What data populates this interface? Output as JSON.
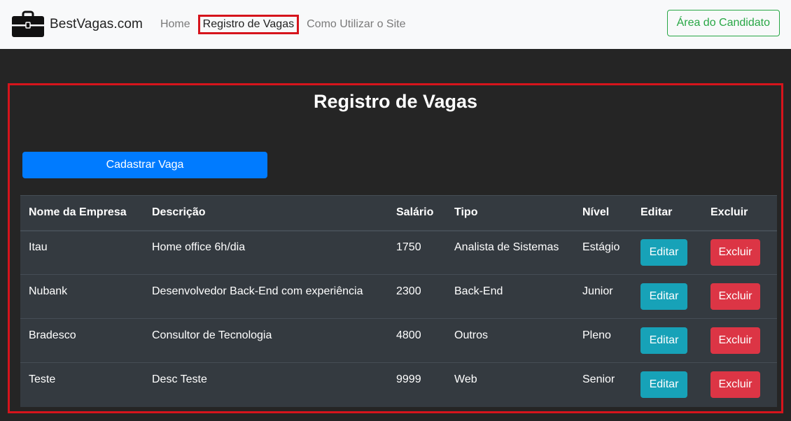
{
  "brand": {
    "name": "BestVagas.com",
    "logo_icon": "briefcase-icon"
  },
  "nav": {
    "links": [
      {
        "label": "Home",
        "active": false
      },
      {
        "label": "Registro de Vagas",
        "active": true
      },
      {
        "label": "Como Utilizar o Site",
        "active": false
      }
    ],
    "candidate_button": "Área do Candidato"
  },
  "main": {
    "title": "Registro de Vagas",
    "add_button": "Cadastrar Vaga"
  },
  "table": {
    "headers": [
      "Nome da Empresa",
      "Descrição",
      "Salário",
      "Tipo",
      "Nível",
      "Editar",
      "Excluir"
    ],
    "rows": [
      {
        "empresa": "Itau",
        "descricao": "Home office 6h/dia",
        "salario": "1750",
        "tipo": "Analista de Sistemas",
        "nivel": "Estágio",
        "editar": "Editar",
        "excluir": "Excluir"
      },
      {
        "empresa": "Nubank",
        "descricao": "Desenvolvedor Back-End com experiência",
        "salario": "2300",
        "tipo": "Back-End",
        "nivel": "Junior",
        "editar": "Editar",
        "excluir": "Excluir"
      },
      {
        "empresa": "Bradesco",
        "descricao": "Consultor de Tecnologia",
        "salario": "4800",
        "tipo": "Outros",
        "nivel": "Pleno",
        "editar": "Editar",
        "excluir": "Excluir"
      },
      {
        "empresa": "Teste",
        "descricao": "Desc Teste",
        "salario": "9999",
        "tipo": "Web",
        "nivel": "Senior",
        "editar": "Editar",
        "excluir": "Excluir"
      }
    ]
  },
  "colors": {
    "navbar_bg": "#f8f9fa",
    "page_bg": "#252525",
    "table_bg": "#343a40",
    "primary": "#007bff",
    "info": "#17a2b8",
    "danger": "#dc3545",
    "success": "#28a745",
    "highlight": "#d6141c"
  }
}
